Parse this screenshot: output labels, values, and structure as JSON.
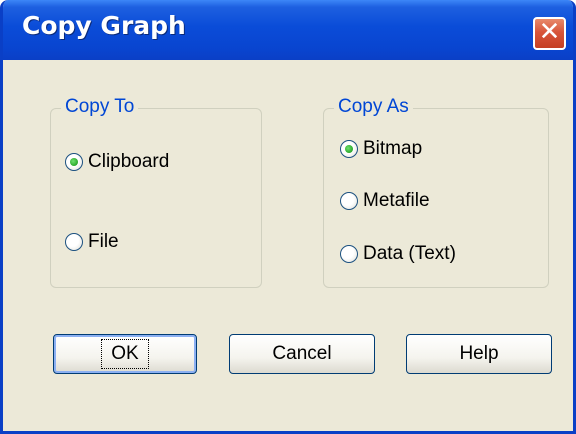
{
  "window": {
    "title": "Copy Graph",
    "close_icon": "close-icon"
  },
  "copy_to": {
    "legend": "Copy To",
    "options": [
      {
        "label": "Clipboard",
        "checked": true
      },
      {
        "label": "File",
        "checked": false
      }
    ]
  },
  "copy_as": {
    "legend": "Copy As",
    "options": [
      {
        "label": "Bitmap",
        "checked": true
      },
      {
        "label": "Metafile",
        "checked": false
      },
      {
        "label": "Data (Text)",
        "checked": false
      }
    ]
  },
  "buttons": {
    "ok": "OK",
    "cancel": "Cancel",
    "help": "Help"
  },
  "colors": {
    "titlebar": "#0a4cd8",
    "dialog_bg": "#ece9d8",
    "group_legend": "#0046d5",
    "close_button": "#d8553a"
  }
}
